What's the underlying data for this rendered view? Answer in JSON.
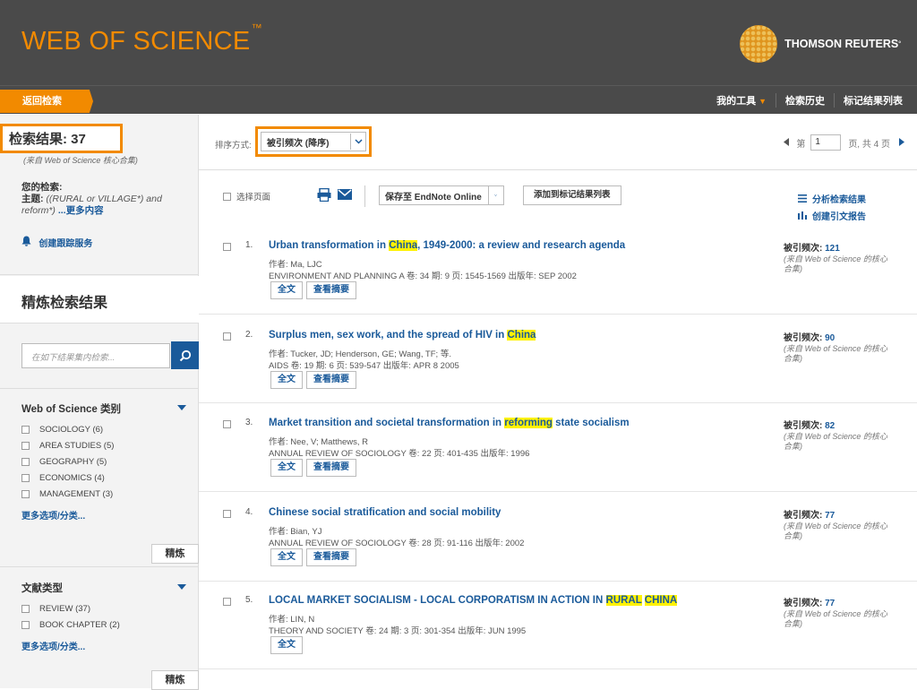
{
  "header": {
    "logo": "WEB OF SCIENCE",
    "logo_tm": "™",
    "brand": "THOMSON REUTERS",
    "brand_mark": "°"
  },
  "nav": {
    "back": "返回检索",
    "my_tools": "我的工具",
    "my_tools_arrow": "▼",
    "history": "检索历史",
    "marked": "标记结果列表"
  },
  "left": {
    "results_label": "检索结果: 37",
    "results_sub": "(来自 Web of Science 核心合集)",
    "your_search_label": "您的检索:",
    "topic_label": "主题:",
    "query": "((RURAL or VILLAGE*) and reform*)",
    "more_content": "...更多内容",
    "create_alert": "创建跟踪服务",
    "refine_title": "精炼检索结果",
    "search_placeholder": "在如下结果集内检索...",
    "facets": [
      {
        "title": "Web of Science 类别",
        "items": [
          "SOCIOLOGY (6)",
          "AREA STUDIES (5)",
          "GEOGRAPHY (5)",
          "ECONOMICS (4)",
          "MANAGEMENT (3)"
        ],
        "more": "更多选项/分类...",
        "refine": "精炼"
      },
      {
        "title": "文献类型",
        "items": [
          "REVIEW (37)",
          "BOOK CHAPTER (2)"
        ],
        "more": "更多选项/分类...",
        "refine": "精炼"
      }
    ]
  },
  "sort": {
    "label": "排序方式:",
    "value": "被引频次 (降序)",
    "page_prefix": "第",
    "page_value": "1",
    "page_suffix": "页, 共 4 页"
  },
  "toolbar": {
    "select_page": "选择页面",
    "save_endnote": "保存至 EndNote Online",
    "add_marked": "添加到标记结果列表",
    "analyze": "分析检索结果",
    "citation_report": "创建引文报告"
  },
  "records": [
    {
      "num": "1.",
      "t1": "Urban transformation in ",
      "h1": "China",
      "t2": ", 1949-2000: a review and research agenda",
      "h2": "",
      "t3": "",
      "author": "作者: Ma, LJC",
      "source": "ENVIRONMENT AND PLANNING A  卷: 34  期: 9  页: 1545-1569  出版年: SEP 2002",
      "fulltext": "全文",
      "abstract": "查看摘要",
      "cited_label": "被引频次: ",
      "cited": "121",
      "cited_note": "(来自 Web of Science 的核心合集)"
    },
    {
      "num": "2.",
      "t1": "Surplus men, sex work, and the spread of HIV in ",
      "h1": "China",
      "t2": "",
      "h2": "",
      "t3": "",
      "author": "作者: Tucker, JD; Henderson, GE; Wang, TF; 等.",
      "source": "AIDS  卷: 19  期: 6  页: 539-547  出版年: APR 8 2005",
      "fulltext": "全文",
      "abstract": "查看摘要",
      "cited_label": "被引频次: ",
      "cited": "90",
      "cited_note": "(来自 Web of Science 的核心合集)"
    },
    {
      "num": "3.",
      "t1": "Market transition and societal transformation in ",
      "h1": "reforming",
      "t2": " state socialism",
      "h2": "",
      "t3": "",
      "author": "作者: Nee, V; Matthews, R",
      "source": "ANNUAL REVIEW OF SOCIOLOGY  卷: 22  页: 401-435  出版年: 1996",
      "fulltext": "全文",
      "abstract": "查看摘要",
      "cited_label": "被引频次: ",
      "cited": "82",
      "cited_note": "(来自 Web of Science 的核心合集)"
    },
    {
      "num": "4.",
      "t1": "Chinese social stratification and social mobility",
      "h1": "",
      "t2": "",
      "h2": "",
      "t3": "",
      "author": "作者: Bian, YJ",
      "source": "ANNUAL REVIEW OF SOCIOLOGY  卷: 28  页: 91-116  出版年: 2002",
      "fulltext": "全文",
      "abstract": "查看摘要",
      "cited_label": "被引频次: ",
      "cited": "77",
      "cited_note": "(来自 Web of Science 的核心合集)"
    },
    {
      "num": "5.",
      "t1": "LOCAL MARKET SOCIALISM - LOCAL CORPORATISM IN ACTION IN ",
      "h1": "RURAL",
      "t2": " ",
      "h2": "CHINA",
      "t3": "",
      "author": "作者: LIN, N",
      "source": "THEORY AND SOCIETY  卷: 24  期: 3  页: 301-354  出版年: JUN 1995",
      "fulltext": "全文",
      "abstract": "",
      "cited_label": "被引频次: ",
      "cited": "77",
      "cited_note": "(来自 Web of Science 的核心合集)"
    }
  ],
  "colors": {
    "accent": "#f28a00",
    "header_bg": "#4a4a4a",
    "link": "#1a5a9a",
    "highlight": "#fff200"
  },
  "icons": {
    "alert": "bell-icon",
    "search": "search-icon",
    "print": "print-icon",
    "email": "email-icon",
    "analyze": "list-icon",
    "report": "bar-chart-icon"
  }
}
